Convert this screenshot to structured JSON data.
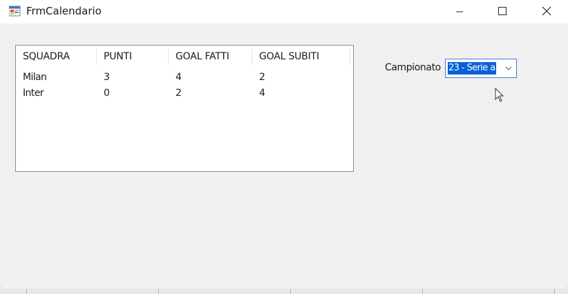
{
  "window": {
    "title": "FrmCalendario"
  },
  "table": {
    "headers": [
      "SQUADRA",
      "PUNTI",
      "GOAL FATTI",
      "GOAL SUBITI"
    ],
    "rows": [
      [
        "Milan",
        "3",
        "4",
        "2"
      ],
      [
        "Inter",
        "0",
        "2",
        "4"
      ]
    ]
  },
  "campionato": {
    "label": "Campionato",
    "selected": "23 - Serie a"
  },
  "colors": {
    "selection": "#0a61d6",
    "window_bg": "#f0f0f0",
    "combo_border": "#3c7fd6"
  },
  "icons": [
    "app-form-icon",
    "minimize-icon",
    "maximize-icon",
    "close-icon",
    "chevron-down-icon",
    "mouse-pointer-icon"
  ]
}
